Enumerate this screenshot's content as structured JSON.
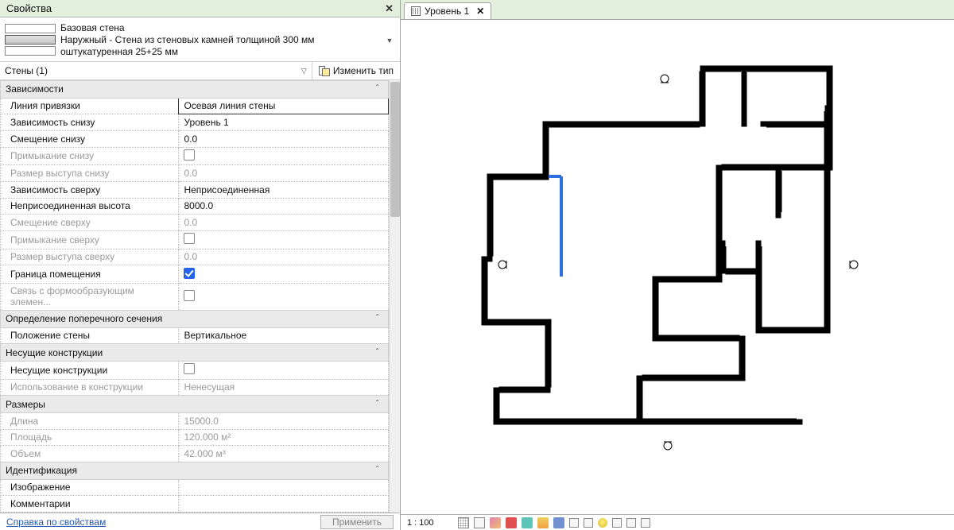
{
  "panel": {
    "title": "Свойства",
    "type_title": "Базовая стена",
    "type_sub": "Наружный - Стена из стеновых камней толщиной 300 мм оштукатуренная 25+25 мм",
    "filter": "Стены (1)",
    "edit_type": "Изменить тип",
    "groups": [
      {
        "label": "Зависимости",
        "rows": [
          {
            "label": "Линия привязки",
            "value": "Осевая линия стены",
            "active": true,
            "indent": 1
          },
          {
            "label": "Зависимость снизу",
            "value": "Уровень 1",
            "indent": 1
          },
          {
            "label": "Смещение снизу",
            "value": "0.0",
            "indent": 1
          },
          {
            "label": "Примыкание снизу",
            "value": "",
            "kind": "check",
            "checked": false,
            "indent": 1,
            "disabled": true
          },
          {
            "label": "Размер выступа снизу",
            "value": "0.0",
            "indent": 1,
            "disabled": true
          },
          {
            "label": "Зависимость сверху",
            "value": "Неприсоединенная",
            "indent": 1
          },
          {
            "label": "Неприсоединенная высота",
            "value": "8000.0",
            "indent": 1
          },
          {
            "label": "Смещение сверху",
            "value": "0.0",
            "indent": 1,
            "disabled": true
          },
          {
            "label": "Примыкание сверху",
            "value": "",
            "kind": "check",
            "checked": false,
            "indent": 1,
            "disabled": true
          },
          {
            "label": "Размер выступа сверху",
            "value": "0.0",
            "indent": 1,
            "disabled": true
          },
          {
            "label": "Граница помещения",
            "value": "",
            "kind": "check",
            "checked": true,
            "indent": 1
          },
          {
            "label": "Связь с формообразующим элемен...",
            "value": "",
            "kind": "check",
            "checked": false,
            "indent": 1,
            "disabled": true
          }
        ]
      },
      {
        "label": "Определение поперечного сечения",
        "rows": [
          {
            "label": "Положение стены",
            "value": "Вертикальное",
            "indent": 1
          }
        ]
      },
      {
        "label": "Несущие конструкции",
        "rows": [
          {
            "label": "Несущие конструкции",
            "value": "",
            "kind": "check",
            "checked": false,
            "indent": 1
          },
          {
            "label": "Использование в конструкции",
            "value": "Ненесущая",
            "indent": 1,
            "disabled": true
          }
        ]
      },
      {
        "label": "Размеры",
        "rows": [
          {
            "label": "Длина",
            "value": "15000.0",
            "indent": 1,
            "disabled": true
          },
          {
            "label": "Площадь",
            "value": "120.000 м²",
            "indent": 1,
            "disabled": true
          },
          {
            "label": "Объем",
            "value": "42.000 м³",
            "indent": 1,
            "disabled": true
          }
        ]
      },
      {
        "label": "Идентификация",
        "rows": [
          {
            "label": "Изображение",
            "value": "",
            "indent": 1
          },
          {
            "label": "Комментарии",
            "value": "",
            "indent": 1
          }
        ]
      }
    ],
    "help_link": "Справка по свойствам",
    "apply": "Применить"
  },
  "canvas": {
    "tab": "Уровень 1",
    "scale": "1 : 100"
  }
}
